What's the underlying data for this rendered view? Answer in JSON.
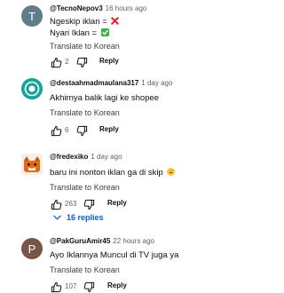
{
  "comments": [
    {
      "author": "@TecnoNepov3",
      "time": "16 hours ago",
      "avatar_letter": "T",
      "avatar_color": "#607d8b",
      "lines": [
        "Ngeskip iklan =",
        "Nyari Iklan ="
      ],
      "line_icons": [
        "cross-mark-icon",
        "check-mark-icon"
      ],
      "translate": "Translate to Korean",
      "likes": "2",
      "reply": "Reply"
    },
    {
      "author": "@destaahmadmaulana317",
      "time": "1 day ago",
      "avatar_color": "#17a398",
      "lines": [
        "Akhirnya balik lagi ke shopee"
      ],
      "translate": "Translate to Korean",
      "likes": "6",
      "reply": "Reply"
    },
    {
      "author": "@fredexiko",
      "time": "1 day ago",
      "avatar_color": "#e46a1b",
      "lines": [
        "baru ini nonton iklan ga di skip"
      ],
      "line_icons": [
        "grinning-sweat-emoji-icon"
      ],
      "translate": "Translate to Korean",
      "likes": "263",
      "reply": "Reply",
      "replies_label": "16 replies"
    },
    {
      "author": "@PakGuruAmir45",
      "time": "22 hours ago",
      "avatar_letter": "P",
      "avatar_color": "#795548",
      "lines": [
        "Ayo Iklannya Muncul di TV juga ya"
      ],
      "translate": "Translate to Korean",
      "likes": "107",
      "reply": "Reply"
    }
  ],
  "colors": {
    "link_blue": "#065fd4",
    "secondary_text": "#606060"
  }
}
